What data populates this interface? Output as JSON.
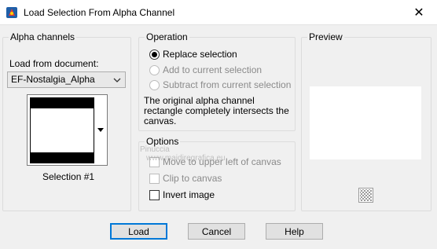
{
  "window": {
    "title": "Load Selection From Alpha Channel",
    "close_glyph": "✕"
  },
  "alpha_channels": {
    "group_label": "Alpha channels",
    "load_from_label": "Load from document:",
    "document_value": "EF-Nostalgia_Alpha",
    "selection_label": "Selection #1"
  },
  "operation": {
    "group_label": "Operation",
    "options": [
      {
        "label": "Replace selection",
        "selected": true,
        "enabled": true
      },
      {
        "label": "Add to current selection",
        "selected": false,
        "enabled": false
      },
      {
        "label": "Subtract from current selection",
        "selected": false,
        "enabled": false
      }
    ],
    "note": "The original alpha channel rectangle completely intersects the canvas."
  },
  "options": {
    "group_label": "Options",
    "items": [
      {
        "label": "Move to upper left of canvas",
        "checked": false,
        "enabled": false
      },
      {
        "label": "Clip to canvas",
        "checked": false,
        "enabled": false
      },
      {
        "label": "Invert image",
        "checked": false,
        "enabled": true
      }
    ]
  },
  "preview": {
    "group_label": "Preview",
    "icon": "transparency-checker-icon"
  },
  "watermark": {
    "line1": "Pinuccia",
    "line2": "www.maidiregrafica.eu"
  },
  "buttons": {
    "load": "Load",
    "cancel": "Cancel",
    "help": "Help"
  },
  "colors": {
    "accent": "#0078d7",
    "dialog_bg": "#f0f0f0",
    "title_bg": "#ffffff"
  }
}
